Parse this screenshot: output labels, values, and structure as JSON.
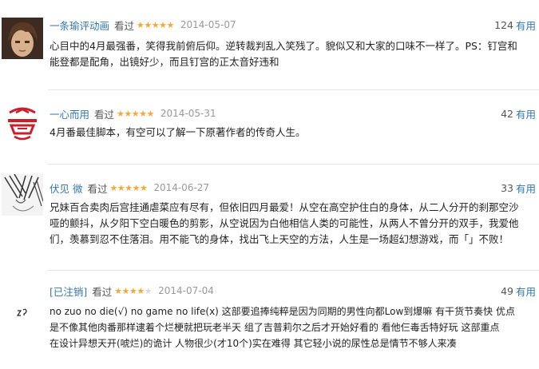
{
  "reviews": [
    {
      "user": "一条瑜评动画",
      "status": "看过",
      "stars": 5,
      "star_text": "★★★★★",
      "date": "2014-05-07",
      "votes": "124",
      "useful_label": "有用",
      "lines": [
        "心目中的4月最强番，笑得我前俯后仰。逆转裁判乱入笑残了。貌似又和大家的口味不一样了。PS：钉宫和",
        "能登都是配角，出镜好少，而且钉宫的正太音好违和"
      ]
    },
    {
      "user": "一心而用",
      "status": "看过",
      "stars": 5,
      "star_text": "★★★★★",
      "date": "2014-05-31",
      "votes": "42",
      "useful_label": "有用",
      "lines": [
        "4月番最佳脚本，有空可以了解一下原著作者的传奇人生。"
      ]
    },
    {
      "user": "伏见 微",
      "status": "看过",
      "stars": 5,
      "star_text": "★★★★★",
      "date": "2014-06-27",
      "votes": "33",
      "useful_label": "有用",
      "lines": [
        "兄妹百合卖肉后宫挂通虐菜应有尽有，但依旧四月最爱！从空在高空护住白的身体，从二人分开的刹那空沙",
        "哑的颤抖，从夕阳下空白暖色的剪影，从空说因为白他相信人类的可能性，从两人不曾分开的双手，我爱他",
        "们，羡慕到忍不住落泪。用不能飞的身体，找出飞上天空的方法，人生是一场超幻想游戏，而「」不败！"
      ]
    },
    {
      "user": "[已注销]",
      "status": "看过",
      "stars": 4,
      "star_text": "★★★★",
      "star_off_text": "★",
      "date": "2014-07-04",
      "votes": "49",
      "useful_label": "有用",
      "lines": [
        "no zuo no die(√) no game no life(x) 这部要追捧纯粹是因为同期的男性向都Low到爆嘛 有干货节奏快 优点",
        "是不像其他肉番那样逮着个烂梗就把玩老半天 组了吉普莉尔之后才开始好看的 看他仨毒舌特好玩 这部重点",
        "在设计异想天开(唬烂)的诡计 人物很少(才10个)实在难得 其它轻小说的尿性总是情节不够人来凑"
      ]
    }
  ]
}
